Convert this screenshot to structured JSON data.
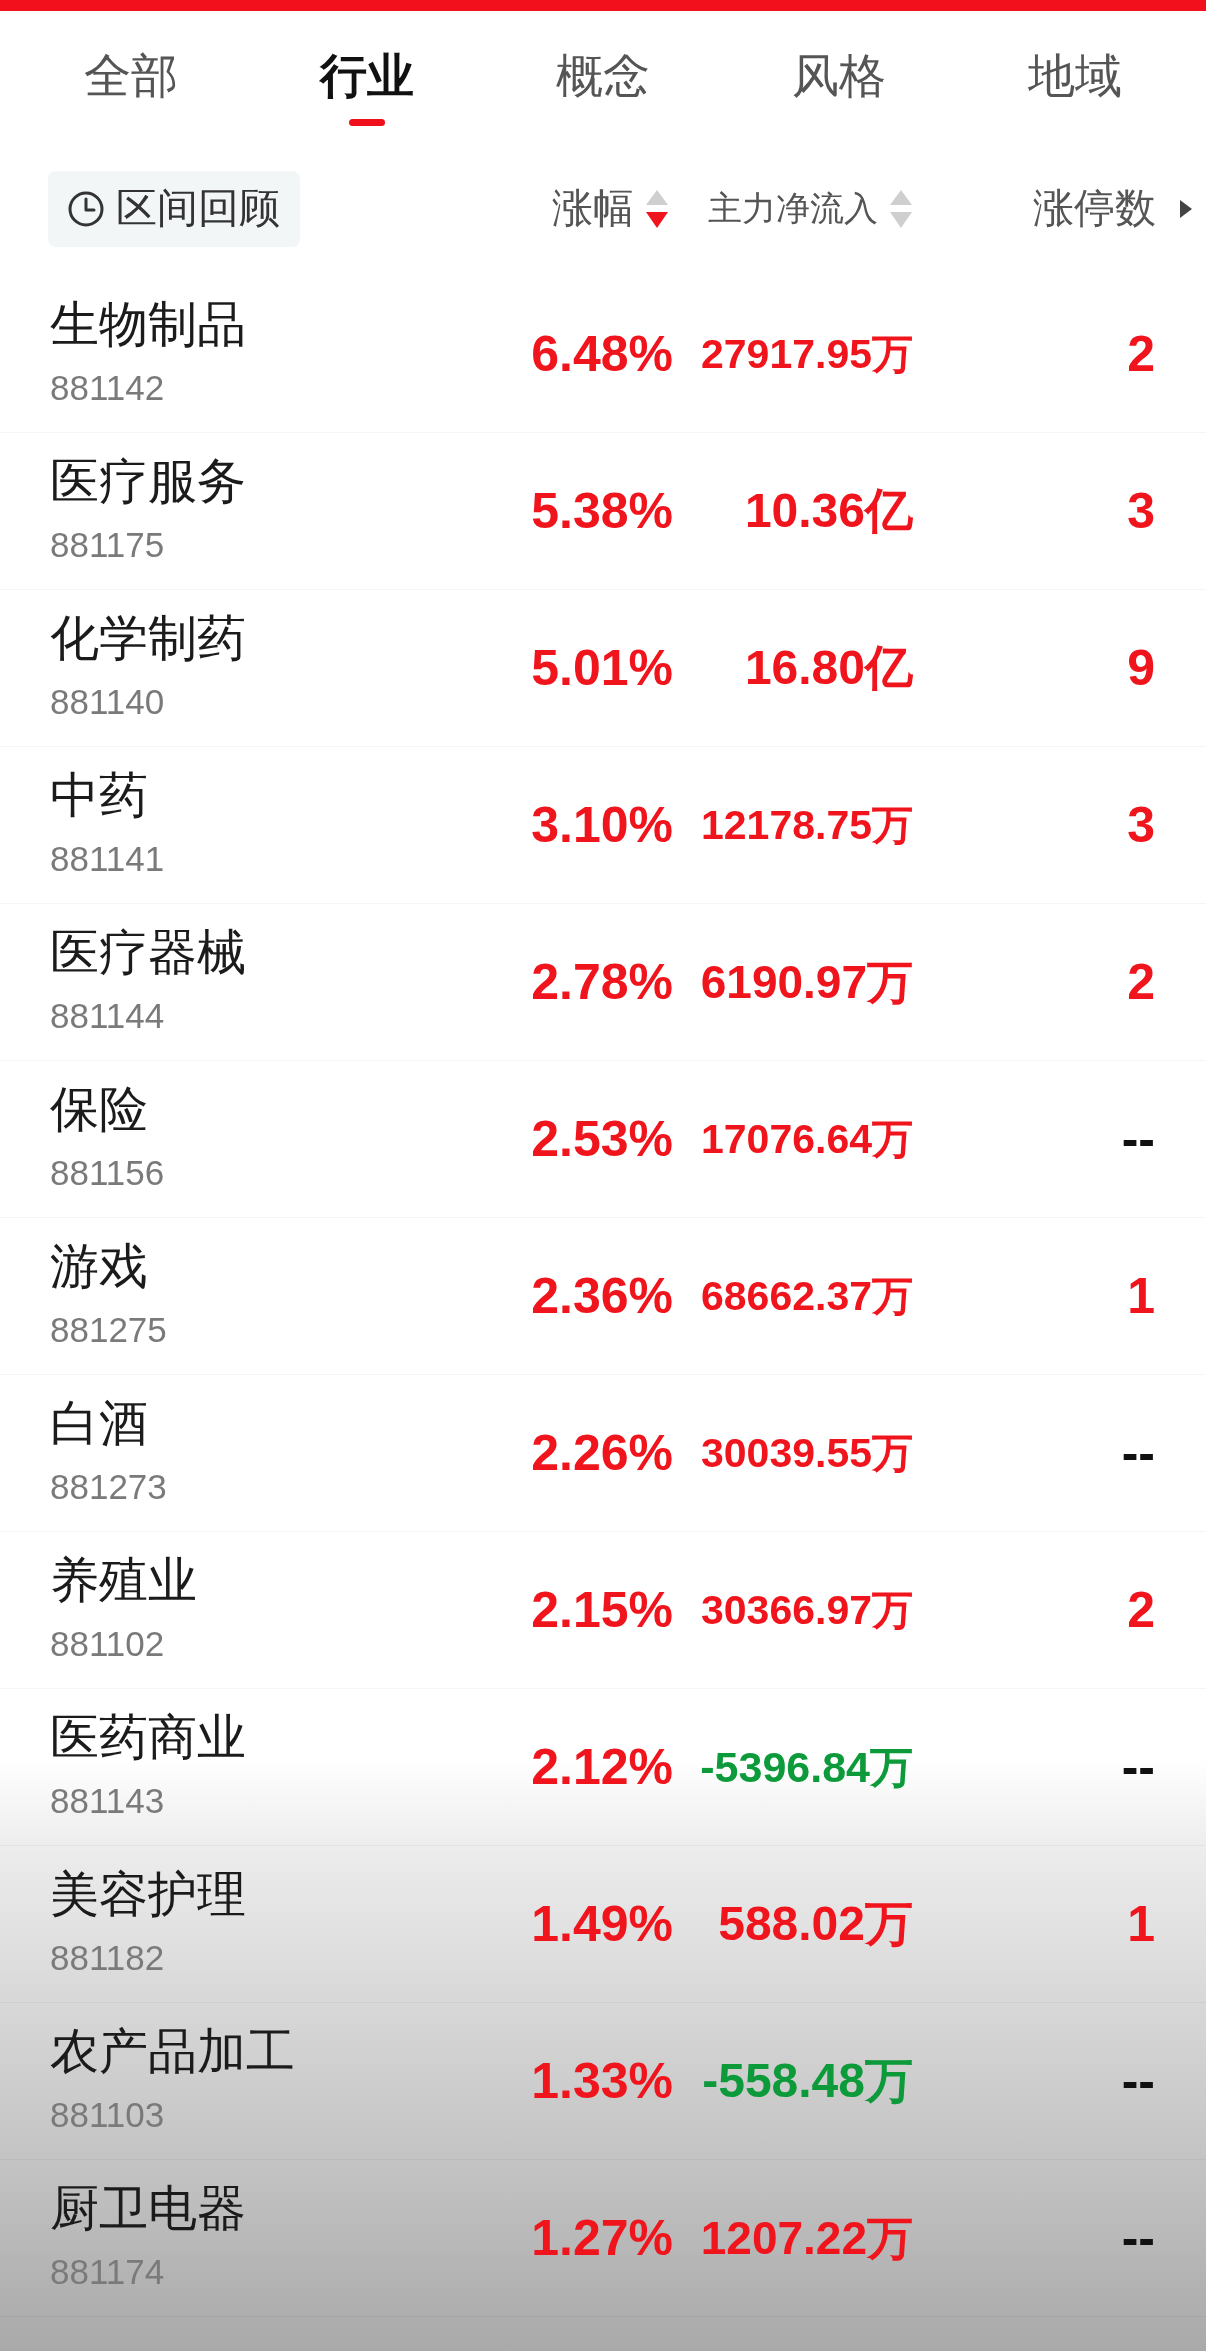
{
  "tabs": [
    {
      "label": "全部",
      "selected": false
    },
    {
      "label": "行业",
      "selected": true
    },
    {
      "label": "概念",
      "selected": false
    },
    {
      "label": "风格",
      "selected": false
    },
    {
      "label": "地域",
      "selected": false
    }
  ],
  "list_header": {
    "review_button": {
      "label": "区间回顾"
    },
    "columns": [
      {
        "label": "涨幅",
        "kind": "sort",
        "selected": true,
        "descending": true
      },
      {
        "label": "主力净流入",
        "kind": "sort",
        "selected": false
      },
      {
        "label": "涨停数",
        "kind": "more"
      }
    ]
  },
  "rows": [
    {
      "name": "生物制品",
      "code": "881142",
      "change": "6.48%",
      "change_up": true,
      "net_inflow": "27917.95万",
      "net_inflow_up": true,
      "limit_up": "2",
      "has_limit_up": true
    },
    {
      "name": "医疗服务",
      "code": "881175",
      "change": "5.38%",
      "change_up": true,
      "net_inflow": "10.36亿",
      "net_inflow_up": true,
      "limit_up": "3",
      "has_limit_up": true
    },
    {
      "name": "化学制药",
      "code": "881140",
      "change": "5.01%",
      "change_up": true,
      "net_inflow": "16.80亿",
      "net_inflow_up": true,
      "limit_up": "9",
      "has_limit_up": true
    },
    {
      "name": "中药",
      "code": "881141",
      "change": "3.10%",
      "change_up": true,
      "net_inflow": "12178.75万",
      "net_inflow_up": true,
      "limit_up": "3",
      "has_limit_up": true
    },
    {
      "name": "医疗器械",
      "code": "881144",
      "change": "2.78%",
      "change_up": true,
      "net_inflow": "6190.97万",
      "net_inflow_up": true,
      "limit_up": "2",
      "has_limit_up": true
    },
    {
      "name": "保险",
      "code": "881156",
      "change": "2.53%",
      "change_up": true,
      "net_inflow": "17076.64万",
      "net_inflow_up": true,
      "limit_up": "--",
      "has_limit_up": false
    },
    {
      "name": "游戏",
      "code": "881275",
      "change": "2.36%",
      "change_up": true,
      "net_inflow": "68662.37万",
      "net_inflow_up": true,
      "limit_up": "1",
      "has_limit_up": true
    },
    {
      "name": "白酒",
      "code": "881273",
      "change": "2.26%",
      "change_up": true,
      "net_inflow": "30039.55万",
      "net_inflow_up": true,
      "limit_up": "--",
      "has_limit_up": false
    },
    {
      "name": "养殖业",
      "code": "881102",
      "change": "2.15%",
      "change_up": true,
      "net_inflow": "30366.97万",
      "net_inflow_up": true,
      "limit_up": "2",
      "has_limit_up": true
    },
    {
      "name": "医药商业",
      "code": "881143",
      "change": "2.12%",
      "change_up": true,
      "net_inflow": "-5396.84万",
      "net_inflow_up": false,
      "limit_up": "--",
      "has_limit_up": false
    },
    {
      "name": "美容护理",
      "code": "881182",
      "change": "1.49%",
      "change_up": true,
      "net_inflow": "588.02万",
      "net_inflow_up": true,
      "limit_up": "1",
      "has_limit_up": true
    },
    {
      "name": "农产品加工",
      "code": "881103",
      "change": "1.33%",
      "change_up": true,
      "net_inflow": "-558.48万",
      "net_inflow_up": false,
      "limit_up": "--",
      "has_limit_up": false
    },
    {
      "name": "厨卫电器",
      "code": "881174",
      "change": "1.27%",
      "change_up": true,
      "net_inflow": "1207.22万",
      "net_inflow_up": true,
      "limit_up": "--",
      "has_limit_up": false
    }
  ]
}
